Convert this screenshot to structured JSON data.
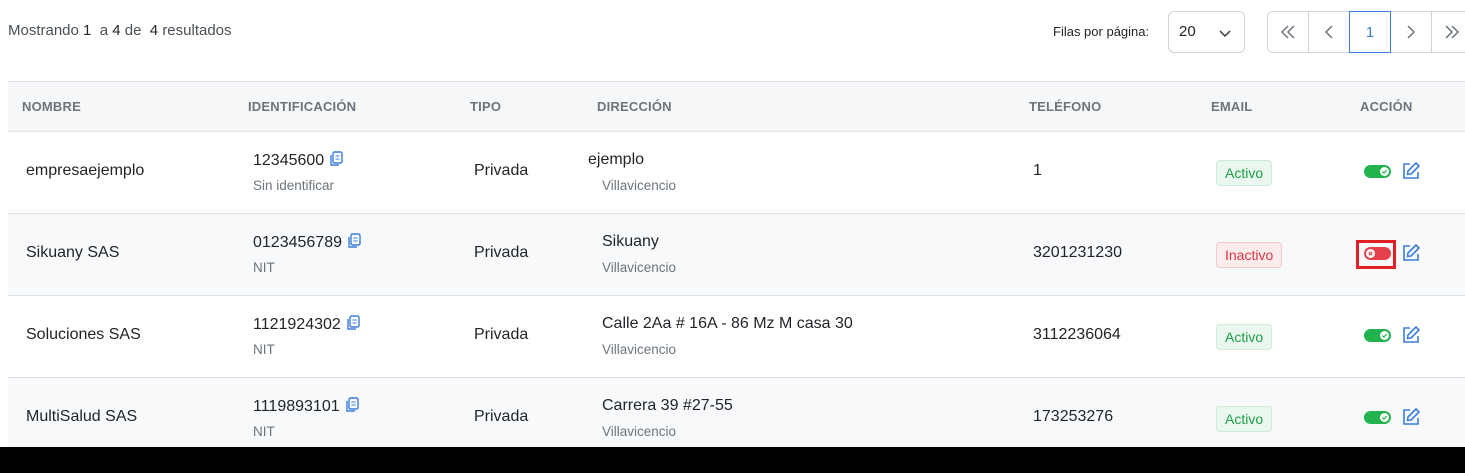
{
  "summary": {
    "prefix": "Mostrando",
    "from": "1",
    "sep": "a",
    "to": "4",
    "of": "de",
    "total": "4",
    "suffix": "resultados"
  },
  "rows_per_page": {
    "label": "Filas por página:",
    "value": "20"
  },
  "pagination": {
    "current": "1"
  },
  "columns": [
    "NOMBRE",
    "IDENTIFICACIÓN",
    "TIPO",
    "DIRECCIÓN",
    "TELÉFONO",
    "EMAIL",
    "ACCIÓN"
  ],
  "rows": [
    {
      "name": "empresaejemplo",
      "id": "12345600",
      "id_type": "Sin identificar",
      "type": "Privada",
      "address": "ejemplo",
      "city": "Villavicencio",
      "phone": "1",
      "status": "Activo",
      "enabled": true
    },
    {
      "name": "Sikuany SAS",
      "id": "0123456789",
      "id_type": "NIT",
      "type": "Privada",
      "address": "Sikuany",
      "city": "Villavicencio",
      "phone": "3201231230",
      "status": "Inactivo",
      "enabled": false
    },
    {
      "name": "Soluciones SAS",
      "id": "1121924302",
      "id_type": "NIT",
      "type": "Privada",
      "address": "Calle 2Aa # 16A - 86 Mz M casa 30",
      "city": "Villavicencio",
      "phone": "3112236064",
      "status": "Activo",
      "enabled": true
    },
    {
      "name": "MultiSalud SAS",
      "id": "1119893101",
      "id_type": "NIT",
      "type": "Privada",
      "address": "Carrera 39 #27-55",
      "city": "Villavicencio",
      "phone": "173253276",
      "status": "Activo",
      "enabled": true
    }
  ],
  "icons": {
    "copy": "copy-icon",
    "edit": "edit-icon",
    "toggle": "toggle-switch-icon",
    "first": "chevrons-left-icon",
    "prev": "chevron-left-icon",
    "next": "chevron-right-icon",
    "last": "chevrons-right-icon",
    "dropdown": "chevron-down-icon"
  },
  "colors": {
    "active_badge": "#1e9e4a",
    "inactive_badge": "#dc3545",
    "toggle_on": "#22b34f",
    "toggle_off": "#e5414d",
    "accent": "#3b7ddd",
    "highlight": "#e01f26"
  }
}
